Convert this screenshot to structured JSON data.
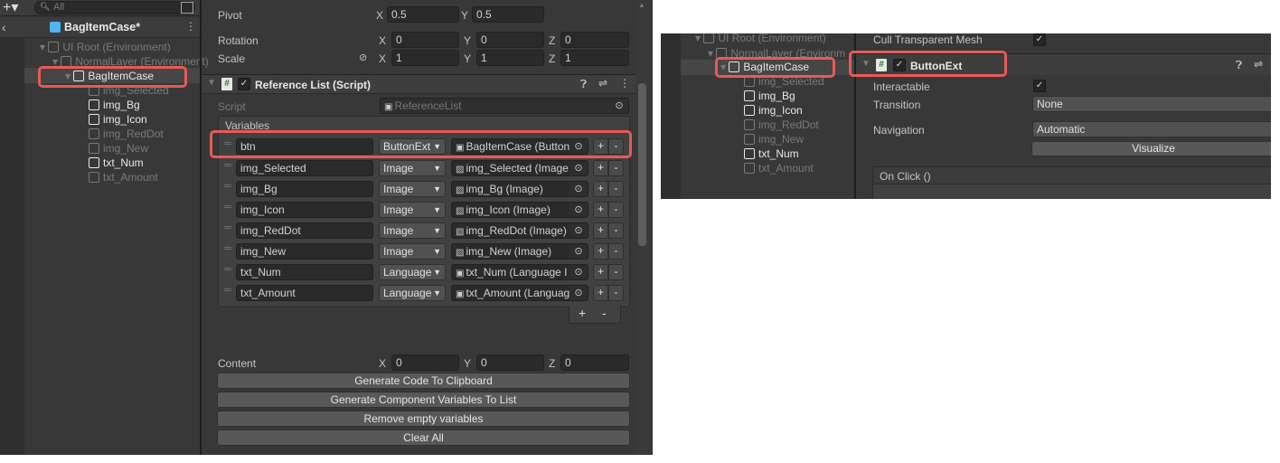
{
  "hierarchy": {
    "search_placeholder": "All",
    "scene_title": "BagItemCase*",
    "items": [
      {
        "label": "UI Root (Environment)",
        "active": false
      },
      {
        "label": "NormalLayer (Environment)",
        "active": false
      },
      {
        "label": "BagItemCase",
        "active": true,
        "selected": true
      },
      {
        "label": "img_Selected",
        "active": false
      },
      {
        "label": "img_Bg",
        "active": true
      },
      {
        "label": "img_Icon",
        "active": true
      },
      {
        "label": "img_RedDot",
        "active": false
      },
      {
        "label": "img_New",
        "active": false
      },
      {
        "label": "txt_Num",
        "active": true
      },
      {
        "label": "txt_Amount",
        "active": false
      }
    ]
  },
  "transform": {
    "pivot_label": "Pivot",
    "pivot": {
      "x": "0.5",
      "y": "0.5"
    },
    "rotation_label": "Rotation",
    "rotation": {
      "x": "0",
      "y": "0",
      "z": "0"
    },
    "scale_label": "Scale",
    "scale": {
      "x": "1",
      "y": "1",
      "z": "1"
    },
    "axis": {
      "x": "X",
      "y": "Y",
      "z": "Z"
    }
  },
  "component": {
    "title": "Reference List (Script)",
    "script_label": "Script",
    "script_value": "ReferenceList",
    "variables_label": "Variables",
    "rows": [
      {
        "name": "btn",
        "type": "ButtonExt",
        "ref": "BagItemCase (Button"
      },
      {
        "name": "img_Selected",
        "type": "Image",
        "ref": "img_Selected (Image"
      },
      {
        "name": "img_Bg",
        "type": "Image",
        "ref": "img_Bg (Image)"
      },
      {
        "name": "img_Icon",
        "type": "Image",
        "ref": "img_Icon (Image)"
      },
      {
        "name": "img_RedDot",
        "type": "Image",
        "ref": "img_RedDot (Image)"
      },
      {
        "name": "img_New",
        "type": "Image",
        "ref": "img_New (Image)"
      },
      {
        "name": "txt_Num",
        "type": "Language",
        "ref": "txt_Num (Language I"
      },
      {
        "name": "txt_Amount",
        "type": "Language",
        "ref": "txt_Amount (Languag"
      }
    ],
    "plus": "+",
    "minus": "-",
    "content_label": "Content",
    "content": {
      "x": "0",
      "y": "0",
      "z": "0"
    },
    "buttons": [
      "Generate Code To Clipboard",
      "Generate Component Variables To List",
      "Remove empty variables",
      "Clear All"
    ]
  },
  "right": {
    "hierarchy": [
      "UI Root (Environment)",
      "NormalLayer (Environm",
      "BagItemCase",
      "img_Selected",
      "img_Bg",
      "img_Icon",
      "img_RedDot",
      "img_New",
      "txt_Num",
      "txt_Amount"
    ],
    "cull_label": "Cull Transparent Mesh",
    "component_title": "ButtonExt",
    "interactable_label": "Interactable",
    "transition_label": "Transition",
    "transition_value": "None",
    "navigation_label": "Navigation",
    "navigation_value": "Automatic",
    "visualize": "Visualize",
    "onclick": "On Click ()"
  },
  "colors": {
    "highlight": "#e85a55",
    "panel": "#383838",
    "field": "#2a2a2a"
  }
}
